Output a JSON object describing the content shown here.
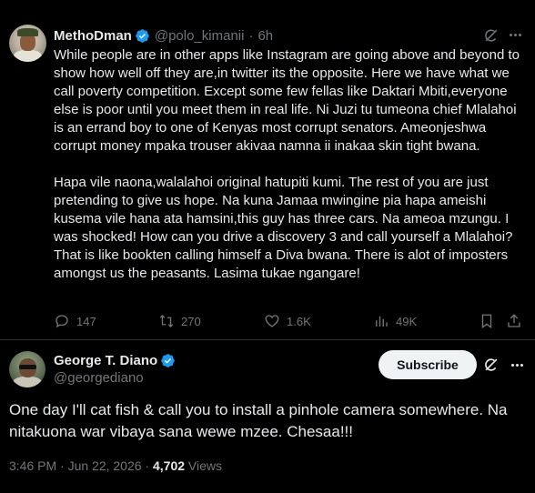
{
  "tweet1": {
    "author_name": "MethoDman",
    "handle": "@polo_kimanii",
    "separator": "·",
    "time": "6h",
    "paragraphs": [
      "While people are in other apps like Instagram are going above and beyond to show how well off they are,in twitter its the opposite. Here we have what we call poverty competition. Except some few fellas like Daktari Mbiti,everyone else is poor until you meet them in real life. Ni Juzi tu tumeona chief Mlalahoi is an errand boy to one of Kenyas most corrupt senators. Ameonjeshwa corrupt money mpaka trouser akivaa namna ii inakaa skin tight bwana.",
      "Hapa vile naona,walalahoi original hatupiti kumi. The rest of you are just pretending to give us hope. Na kuna Jamaa mwingine pia hapa ameishi kusema vile hana ata hamsini,this guy has three cars. Na ameoa mzungu. I was shocked! How can you drive a discovery 3 and call yourself a Mlalahoi? That is like bookten calling himself a Diva bwana. There is alot of imposters amongst us the peasants. Lasima tukae ngangare!"
    ],
    "stats": {
      "replies": "147",
      "reposts": "270",
      "likes": "1.6K",
      "views": "49K"
    }
  },
  "tweet2": {
    "author_name": "George T. Diano",
    "handle": "@georgediano",
    "subscribe_label": "Subscribe",
    "text": "One day I'll cat fish & call you to install a pinhole camera somewhere. Na nitakuona war vibaya sana wewe mzee. Chesaa!!!",
    "timestamp": "3:46 PM · Jun 22, 2026 · ",
    "views_count": "4,702",
    "views_label": " Views"
  },
  "colors": {
    "background": "#000000",
    "text": "#e7e9ea",
    "muted": "#71767b",
    "verified": "#1d9bf0",
    "divider": "#2f3336"
  },
  "icons": [
    "verified-badge-icon",
    "grok-icon",
    "more-icon",
    "reply-icon",
    "repost-icon",
    "like-icon",
    "views-icon",
    "bookmark-icon",
    "share-icon"
  ]
}
